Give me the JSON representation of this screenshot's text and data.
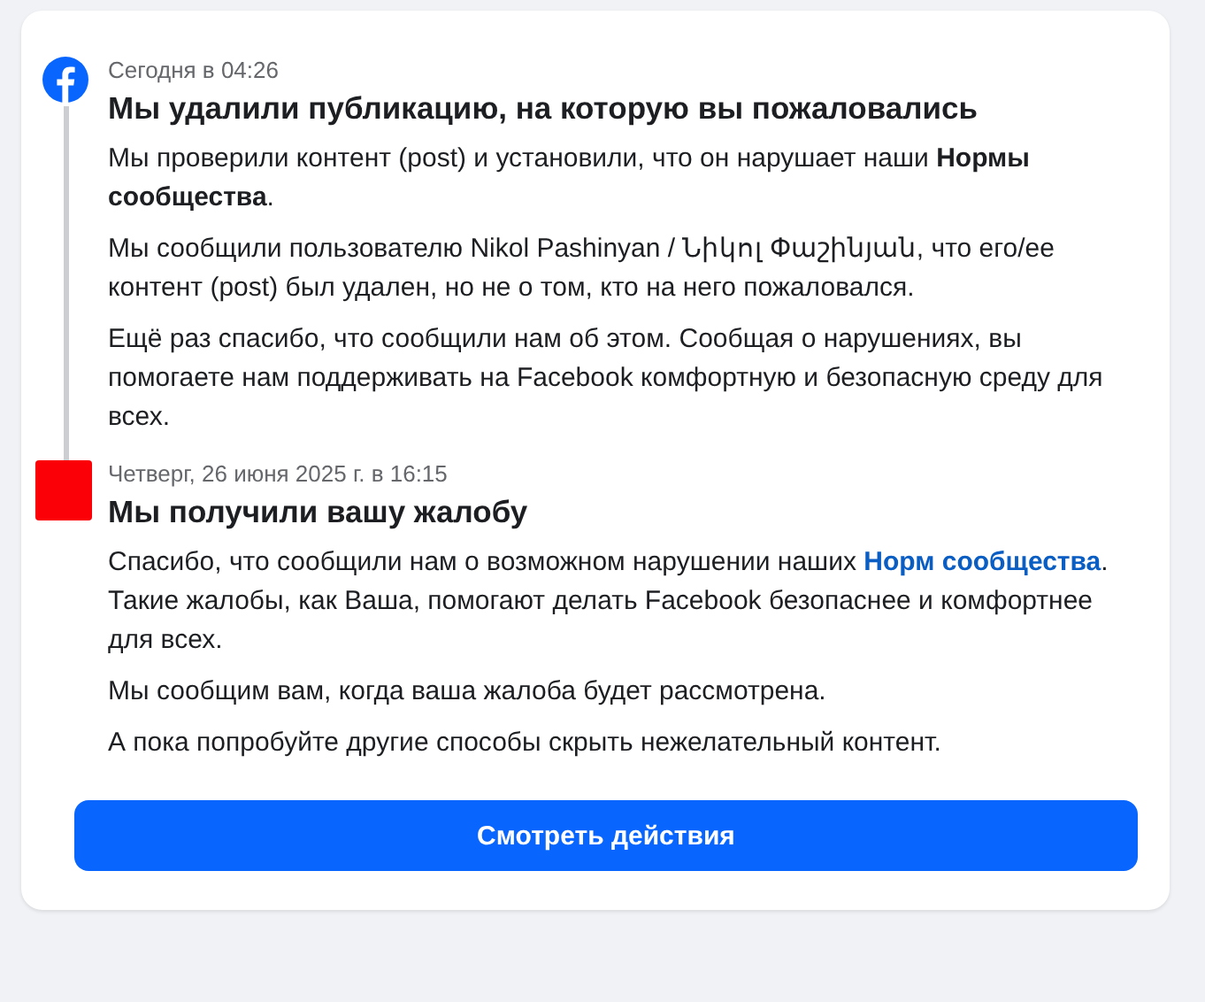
{
  "entries": [
    {
      "kind": "facebook",
      "time": "Сегодня в 04:26",
      "title": "Мы удалили публикацию, на которую вы пожаловались",
      "paragraphs": [
        [
          {
            "kind": "text",
            "text": "Мы проверили контент (post) и установили, что он нарушает наши **Нормы сообщества**."
          }
        ],
        [
          {
            "kind": "text",
            "text": "Мы сообщили пользователю Nikol Pashinyan / Նիկոլ Փաշինյան, что его/ее контент (post) был удален, но не о том, кто на него пожаловался."
          }
        ],
        [
          {
            "kind": "text",
            "text": "Ещё раз спасибо, что сообщили нам об этом. Сообщая о нарушениях, вы помогаете нам поддерживать на Facebook комфортную и безопасную среду для всех."
          }
        ]
      ]
    },
    {
      "kind": "avatar",
      "time": "Четверг, 26 июня 2025 г. в 16:15",
      "title": "Мы получили вашу жалобу",
      "paragraphs": [
        [
          {
            "kind": "text",
            "text": "Спасибо, что сообщили нам о возможном нарушении наших "
          },
          {
            "kind": "link",
            "text": "Норм сообщества"
          },
          {
            "kind": "text",
            "text": ". Такие жалобы, как Ваша, помогают делать Facebook безопаснее и комфортнее для всех."
          }
        ],
        [
          {
            "kind": "text",
            "text": "Мы сообщим вам, когда ваша жалоба будет рассмотрена."
          }
        ],
        [
          {
            "kind": "text",
            "text": "А пока попробуйте другие способы скрыть нежелательный контент."
          }
        ]
      ]
    }
  ],
  "button": "Смотреть действия"
}
